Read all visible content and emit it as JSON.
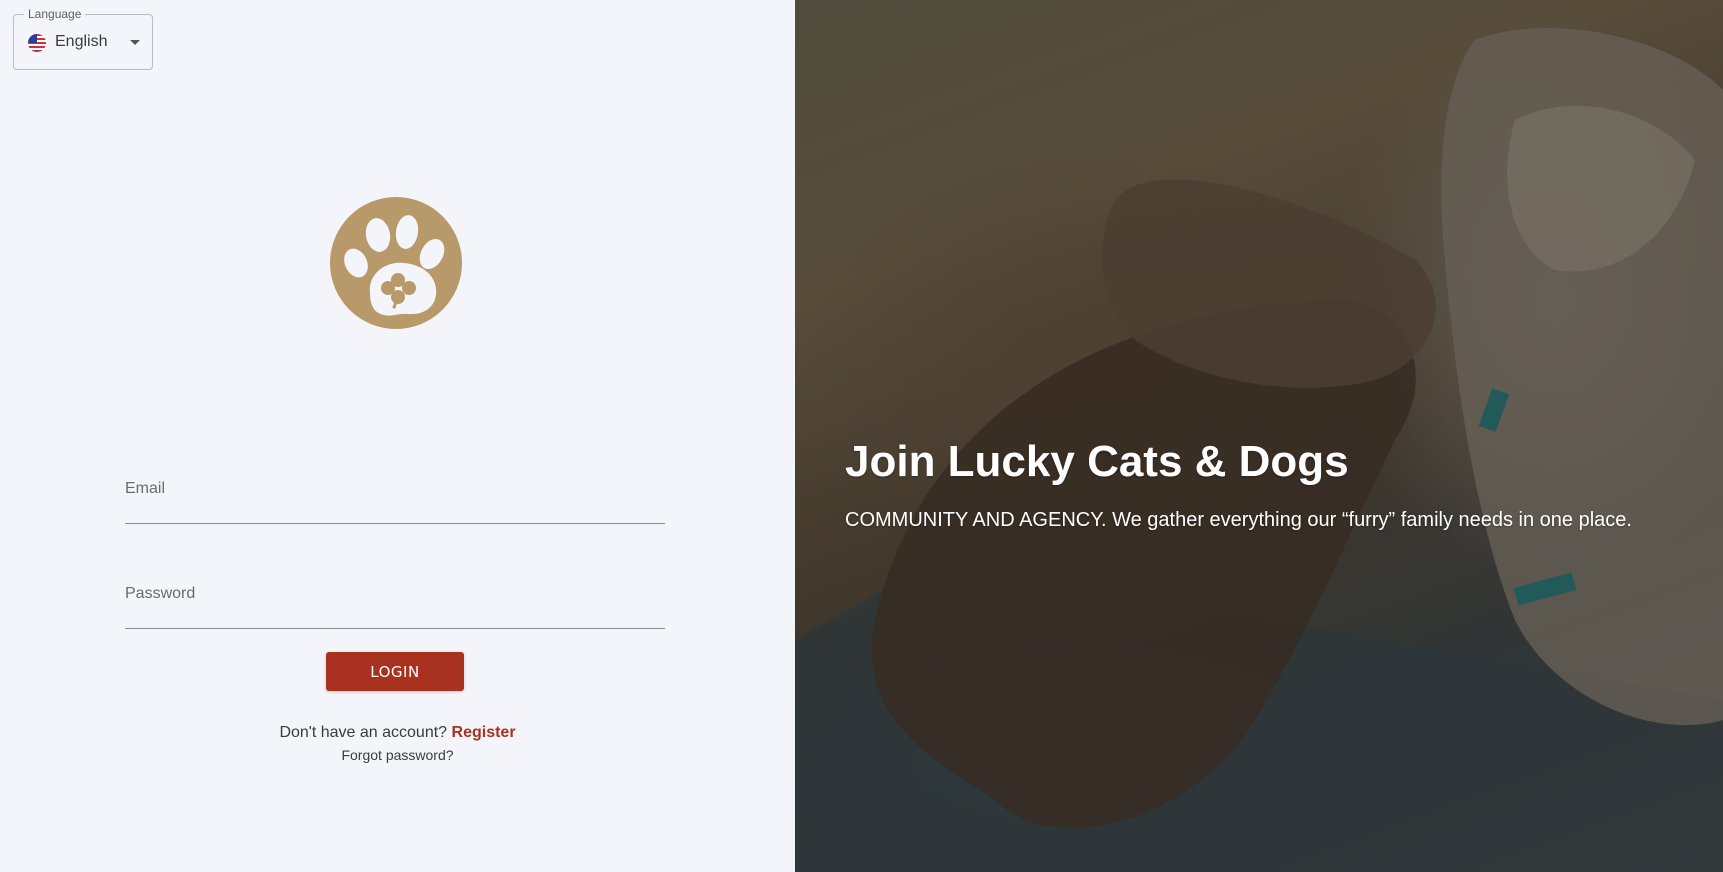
{
  "language": {
    "legend": "Language",
    "selected": "English",
    "flag_icon": "us-flag-icon"
  },
  "brand": {
    "logo_icon": "paw-clover-logo-icon",
    "color": "#b8996a"
  },
  "form": {
    "email_label": "Email",
    "password_label": "Password",
    "login_label": "LOGIN",
    "no_account_text": "Don't have an account?",
    "register_label": "Register",
    "forgot_label": "Forgot password?"
  },
  "hero": {
    "title": "Join Lucky Cats & Dogs",
    "subtitle": "COMMUNITY AND AGENCY. We gather everything our “furry” family needs in one place."
  },
  "colors": {
    "accent": "#a8311f",
    "background": "#f4f5fa"
  }
}
